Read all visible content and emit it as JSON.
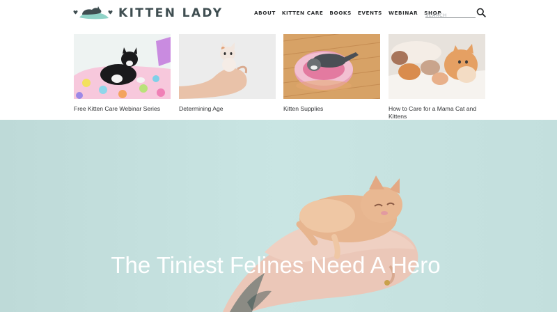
{
  "brand": {
    "name": "KITTEN LADY"
  },
  "nav": {
    "items": [
      {
        "label": "ABOUT",
        "name": "nav-about"
      },
      {
        "label": "KITTEN CARE",
        "name": "nav-kitten-care"
      },
      {
        "label": "BOOKS",
        "name": "nav-books"
      },
      {
        "label": "EVENTS",
        "name": "nav-events"
      },
      {
        "label": "WEBINAR",
        "name": "nav-webinar"
      },
      {
        "label": "SHOP",
        "name": "nav-shop"
      }
    ]
  },
  "search": {
    "placeholder": "SEARCH",
    "icon": "search-icon"
  },
  "cards": [
    {
      "caption": "Free Kitten Care Webinar Series"
    },
    {
      "caption": "Determining Age"
    },
    {
      "caption": "Kitten Supplies"
    },
    {
      "caption": "How to Care for a Mama Cat and Kittens"
    }
  ],
  "hero": {
    "title": "The Tiniest Felines Need A Hero"
  },
  "colors": {
    "brand_text": "#3f4e51",
    "logo_accent": "#8fd3c7",
    "hero_background": "#c6e3e1",
    "text": "#2f3133"
  }
}
